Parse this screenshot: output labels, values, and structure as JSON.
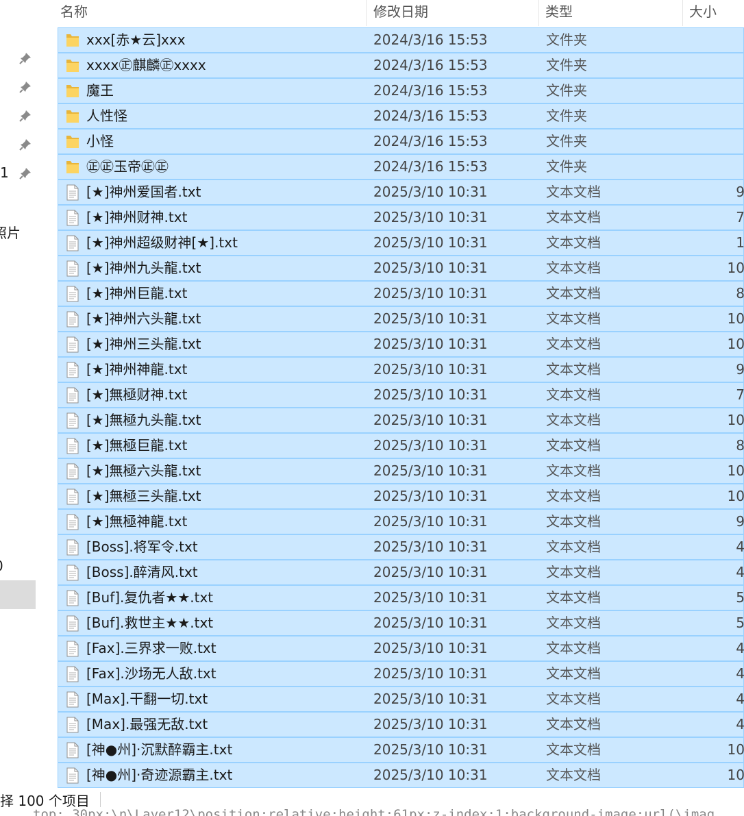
{
  "columns": {
    "name": "名称",
    "date": "修改日期",
    "type": "类型",
    "size": "大小"
  },
  "nav": {
    "fragment_1": "1",
    "fragment_photos": "照片",
    "fragment_0": "0"
  },
  "files": [
    {
      "name": "xxx[赤★云]xxx",
      "date": "2024/3/16 15:53",
      "type": "文件夹",
      "size": "",
      "icon": "folder-icon"
    },
    {
      "name": "xxxx㊣麒麟㊣xxxx",
      "date": "2024/3/16 15:53",
      "type": "文件夹",
      "size": "",
      "icon": "folder-icon"
    },
    {
      "name": "魔王",
      "date": "2024/3/16 15:53",
      "type": "文件夹",
      "size": "",
      "icon": "folder-icon"
    },
    {
      "name": "人性怪",
      "date": "2024/3/16 15:53",
      "type": "文件夹",
      "size": "",
      "icon": "folder-icon"
    },
    {
      "name": "小怪",
      "date": "2024/3/16 15:53",
      "type": "文件夹",
      "size": "",
      "icon": "folder-icon"
    },
    {
      "name": "㊣㊣玉帝㊣㊣",
      "date": "2024/3/16 15:53",
      "type": "文件夹",
      "size": "",
      "icon": "folder-icon"
    },
    {
      "name": "[★]神州爱国者.txt",
      "date": "2025/3/10 10:31",
      "type": "文本文档",
      "size": "9",
      "icon": "text-file-icon"
    },
    {
      "name": "[★]神州财神.txt",
      "date": "2025/3/10 10:31",
      "type": "文本文档",
      "size": "7",
      "icon": "text-file-icon"
    },
    {
      "name": "[★]神州超级财神[★].txt",
      "date": "2025/3/10 10:31",
      "type": "文本文档",
      "size": "1",
      "icon": "text-file-icon"
    },
    {
      "name": "[★]神州九头龍.txt",
      "date": "2025/3/10 10:31",
      "type": "文本文档",
      "size": "10",
      "icon": "text-file-icon"
    },
    {
      "name": "[★]神州巨龍.txt",
      "date": "2025/3/10 10:31",
      "type": "文本文档",
      "size": "8",
      "icon": "text-file-icon"
    },
    {
      "name": "[★]神州六头龍.txt",
      "date": "2025/3/10 10:31",
      "type": "文本文档",
      "size": "10",
      "icon": "text-file-icon"
    },
    {
      "name": "[★]神州三头龍.txt",
      "date": "2025/3/10 10:31",
      "type": "文本文档",
      "size": "10",
      "icon": "text-file-icon"
    },
    {
      "name": "[★]神州神龍.txt",
      "date": "2025/3/10 10:31",
      "type": "文本文档",
      "size": "9",
      "icon": "text-file-icon"
    },
    {
      "name": "[★]無極财神.txt",
      "date": "2025/3/10 10:31",
      "type": "文本文档",
      "size": "7",
      "icon": "text-file-icon"
    },
    {
      "name": "[★]無極九头龍.txt",
      "date": "2025/3/10 10:31",
      "type": "文本文档",
      "size": "10",
      "icon": "text-file-icon"
    },
    {
      "name": "[★]無極巨龍.txt",
      "date": "2025/3/10 10:31",
      "type": "文本文档",
      "size": "8",
      "icon": "text-file-icon"
    },
    {
      "name": "[★]無極六头龍.txt",
      "date": "2025/3/10 10:31",
      "type": "文本文档",
      "size": "10",
      "icon": "text-file-icon"
    },
    {
      "name": "[★]無極三头龍.txt",
      "date": "2025/3/10 10:31",
      "type": "文本文档",
      "size": "10",
      "icon": "text-file-icon"
    },
    {
      "name": "[★]無極神龍.txt",
      "date": "2025/3/10 10:31",
      "type": "文本文档",
      "size": "9",
      "icon": "text-file-icon"
    },
    {
      "name": "[Boss].将军令.txt",
      "date": "2025/3/10 10:31",
      "type": "文本文档",
      "size": "4",
      "icon": "text-file-icon"
    },
    {
      "name": "[Boss].醉清风.txt",
      "date": "2025/3/10 10:31",
      "type": "文本文档",
      "size": "4",
      "icon": "text-file-icon"
    },
    {
      "name": "[Buf].复仇者★★.txt",
      "date": "2025/3/10 10:31",
      "type": "文本文档",
      "size": "5",
      "icon": "text-file-icon"
    },
    {
      "name": "[Buf].救世主★★.txt",
      "date": "2025/3/10 10:31",
      "type": "文本文档",
      "size": "5",
      "icon": "text-file-icon"
    },
    {
      "name": "[Fax].三界求一败.txt",
      "date": "2025/3/10 10:31",
      "type": "文本文档",
      "size": "4",
      "icon": "text-file-icon"
    },
    {
      "name": "[Fax].沙场无人敌.txt",
      "date": "2025/3/10 10:31",
      "type": "文本文档",
      "size": "4",
      "icon": "text-file-icon"
    },
    {
      "name": "[Max].干翻一切.txt",
      "date": "2025/3/10 10:31",
      "type": "文本文档",
      "size": "4",
      "icon": "text-file-icon"
    },
    {
      "name": "[Max].最强无敌.txt",
      "date": "2025/3/10 10:31",
      "type": "文本文档",
      "size": "4",
      "icon": "text-file-icon"
    },
    {
      "name": "[神●州]·沉默醉霸主.txt",
      "date": "2025/3/10 10:31",
      "type": "文本文档",
      "size": "10",
      "icon": "text-file-icon"
    },
    {
      "name": "[神●州]·奇迹源霸主.txt",
      "date": "2025/3/10 10:31",
      "type": "文本文档",
      "size": "10",
      "icon": "text-file-icon"
    }
  ],
  "status": {
    "selection_text": "择 100 个项目"
  },
  "background_code": "top: 30px;\\n\\Layer12\\position:relative;height:61px;z-index:1;background-image:url(\\imag"
}
